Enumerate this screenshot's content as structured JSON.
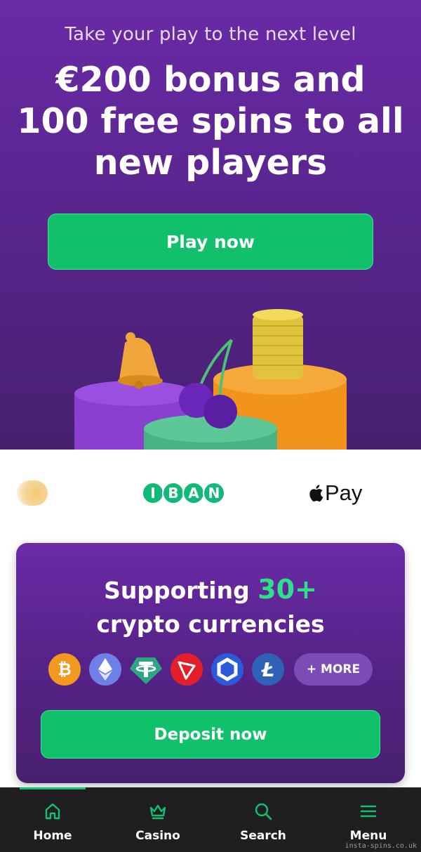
{
  "hero": {
    "kicker": "Take your play to the next level",
    "title": "€200 bonus and 100 free spins to all new players",
    "cta_label": "Play now"
  },
  "payments": {
    "iban_letters": [
      "I",
      "B",
      "A",
      "N"
    ],
    "apple_pay_label": "Pay"
  },
  "crypto": {
    "title_prefix": "Supporting ",
    "title_accent": "30+",
    "title_line2": "crypto currencies",
    "coins": [
      "bitcoin-icon",
      "ethereum-icon",
      "tether-icon",
      "tron-icon",
      "chainlink-icon",
      "litecoin-icon"
    ],
    "more_label": "+ MORE",
    "cta_label": "Deposit now"
  },
  "nav": {
    "items": [
      {
        "label": "Home",
        "icon": "home-icon",
        "active": true
      },
      {
        "label": "Casino",
        "icon": "crown-icon",
        "active": false
      },
      {
        "label": "Search",
        "icon": "search-icon",
        "active": false
      },
      {
        "label": "Menu",
        "icon": "menu-icon",
        "active": false
      }
    ]
  },
  "watermark": "insta-spins.co.uk",
  "colors": {
    "accent_green": "#10c06b",
    "purple": "#5a2590",
    "nav_bg": "#1f1f21"
  }
}
